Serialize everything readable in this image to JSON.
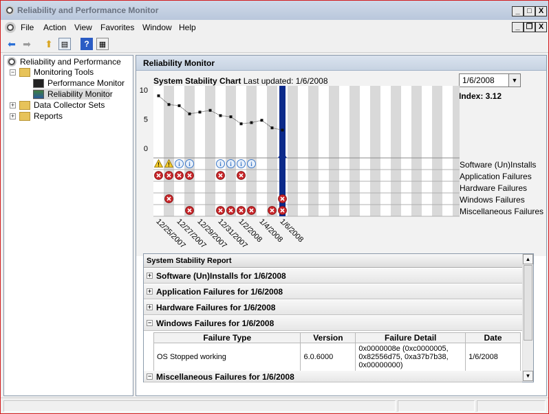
{
  "window": {
    "title": "Reliability and Performance Monitor",
    "minimize": "_",
    "maximize": "□",
    "close": "X"
  },
  "menu": {
    "items": [
      "File",
      "Action",
      "View",
      "Favorites",
      "Window",
      "Help"
    ],
    "child_min": "_",
    "child_restore": "❐",
    "child_close": "X"
  },
  "tree": {
    "root": "Reliability and Performance",
    "monitoring_tools": "Monitoring Tools",
    "performance_monitor": "Performance Monitor",
    "reliability_monitor": "Reliability Monitor",
    "data_collector_sets": "Data Collector Sets",
    "reports": "Reports",
    "expand_plus": "+",
    "expand_minus": "−"
  },
  "panel": {
    "title": "Reliability Monitor"
  },
  "chart": {
    "title": "System Stability Chart",
    "updated": "Last updated: 1/6/2008",
    "selected_date": "1/6/2008",
    "index": "Index: 3.12",
    "row_labels": [
      "Software (Un)Installs",
      "Application Failures",
      "Hardware Failures",
      "Windows Failures",
      "Miscellaneous Failures"
    ]
  },
  "chart_data": {
    "type": "line",
    "title": "System Stability Chart",
    "ylim": [
      0,
      10
    ],
    "y_ticks": [
      "10",
      "5",
      "0"
    ],
    "x_tick_labels": [
      "12/25/2007",
      "12/27/2007",
      "12/29/2007",
      "12/31/2007",
      "1/2/2008",
      "1/4/2008",
      "1/6/2008"
    ],
    "series": [
      {
        "values": [
          9,
          7.5,
          7.3,
          5.9,
          6.2,
          6.5,
          5.6,
          5.4,
          4.2,
          4.4,
          4.8,
          3.5,
          3.12
        ]
      }
    ],
    "selected_index": 12,
    "events": {
      "software_installs": [
        {
          "col": 0,
          "type": "warning"
        },
        {
          "col": 1,
          "type": "warning"
        },
        {
          "col": 2,
          "type": "info"
        },
        {
          "col": 3,
          "type": "info"
        },
        {
          "col": 6,
          "type": "info"
        },
        {
          "col": 7,
          "type": "info"
        },
        {
          "col": 8,
          "type": "info"
        },
        {
          "col": 9,
          "type": "info"
        }
      ],
      "application_failures": [
        0,
        1,
        2,
        3,
        6,
        8
      ],
      "hardware_failures": [],
      "windows_failures": [
        1,
        12
      ],
      "misc_failures": [
        3,
        6,
        7,
        8,
        9,
        11,
        12
      ]
    }
  },
  "report": {
    "header": "System Stability Report",
    "sections": [
      {
        "label": "Software (Un)Installs for 1/6/2008",
        "expander": "+"
      },
      {
        "label": "Application Failures for 1/6/2008",
        "expander": "+"
      },
      {
        "label": "Hardware Failures for 1/6/2008",
        "expander": "+"
      },
      {
        "label": "Windows Failures for 1/6/2008",
        "expander": "−"
      },
      {
        "label": "Miscellaneous Failures for 1/6/2008",
        "expander": "−"
      }
    ],
    "columns": [
      "Failure Type",
      "Version",
      "Failure Detail",
      "Date"
    ],
    "rows": [
      {
        "failure_type": "OS Stopped working",
        "version": "6.0.6000",
        "detail": "0x0000008e (0xc0000005, 0x82556d75, 0xa37b7b38, 0x00000000)",
        "date": "1/6/2008"
      }
    ],
    "scroll_up": "▲",
    "scroll_down": "▼"
  },
  "colors": {
    "error": "#c8262a",
    "warning": "#f5cc2a",
    "info": "#3b78c8",
    "selected": "#0c2a8a"
  }
}
